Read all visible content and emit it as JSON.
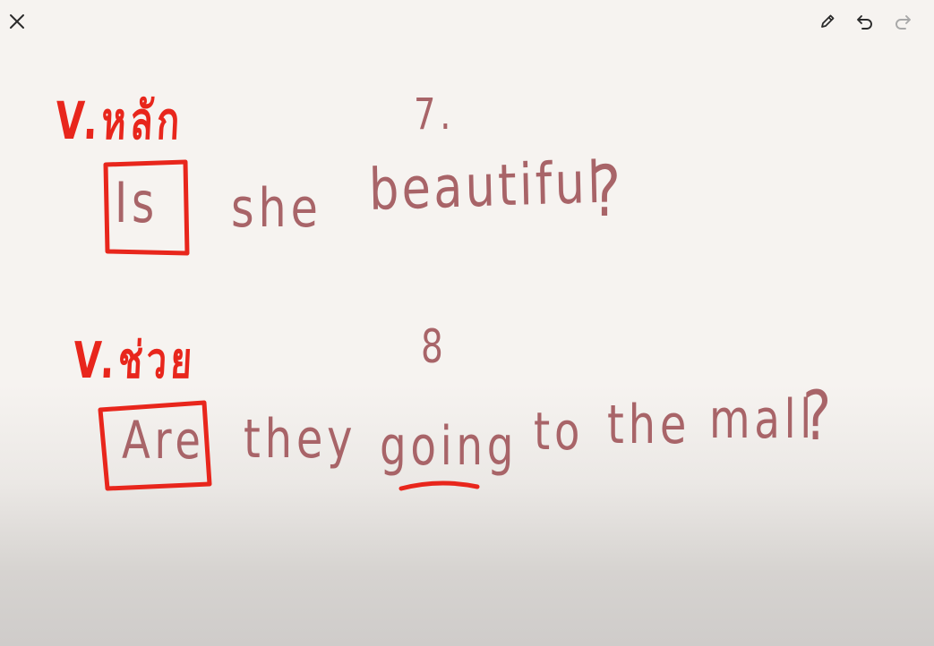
{
  "toolbar": {
    "close_icon": "close-icon",
    "pen_icon": "pencil-icon",
    "undo_icon": "undo-icon",
    "redo_icon": "redo-icon"
  },
  "colors": {
    "red_ink": "#e8261c",
    "mauve_ink": "#a86468",
    "background": "#f6f3f0"
  },
  "board": {
    "item_1": {
      "label": "V.หลัก",
      "number": "7.",
      "words": [
        "Is",
        "she",
        "beautiful"
      ],
      "question_mark": "?"
    },
    "item_2": {
      "label": "V.ช่วย",
      "number": "8",
      "words": [
        "Are",
        "they",
        "going",
        "to",
        "the",
        "mall"
      ],
      "question_mark": "?"
    }
  }
}
